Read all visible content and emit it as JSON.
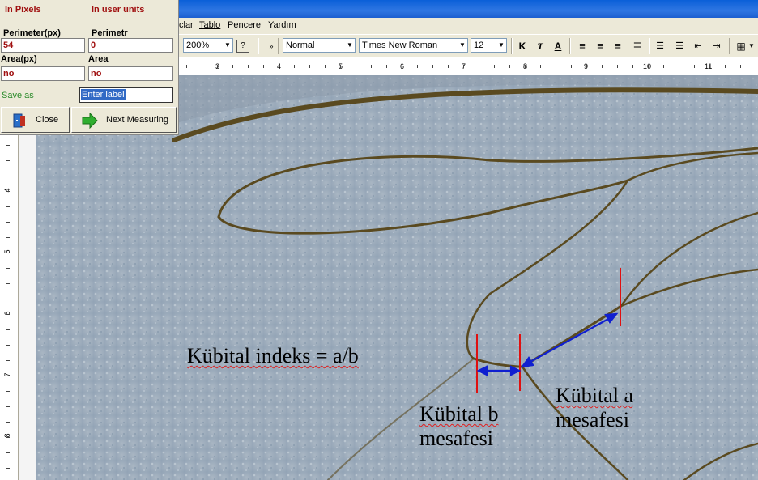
{
  "menu": {
    "items": [
      "clar",
      "Tablo",
      "Pencere",
      "Yardım"
    ]
  },
  "toolbar": {
    "zoom": "200%",
    "style": "Normal",
    "font": "Times New Roman",
    "size": "12",
    "bold": "K",
    "italic": "T",
    "underline": "A"
  },
  "ruler": {
    "h_numbers": [
      "3",
      "4",
      "5",
      "6",
      "7",
      "8",
      "9",
      "10",
      "11"
    ],
    "v_numbers": [
      "4",
      "5",
      "6",
      "7",
      "8"
    ]
  },
  "dialog": {
    "head_pixels": "In Pixels",
    "head_units": "In user units",
    "perimeter_px_label": "Perimeter(px)",
    "perimeter_px_value": "54",
    "perimeter_label": "Perimetr",
    "perimeter_value": "0",
    "area_px_label": "Area(px)",
    "area_px_value": "no",
    "area_label": "Area",
    "area_value": "no",
    "save_as": "Save as",
    "label_input": "Enter label",
    "close_button": "Close",
    "next_button": "Next Measuring"
  },
  "annotations": {
    "index": "Kübital indeks = a/b",
    "b_line1": "Kübital b",
    "b_line2": "mesafesi",
    "a_line1": "Kübital a",
    "a_line2": "mesafesi"
  },
  "colors": {
    "marker": "#e01010",
    "arrow": "#1020d0",
    "vein": "#5a4a20"
  }
}
